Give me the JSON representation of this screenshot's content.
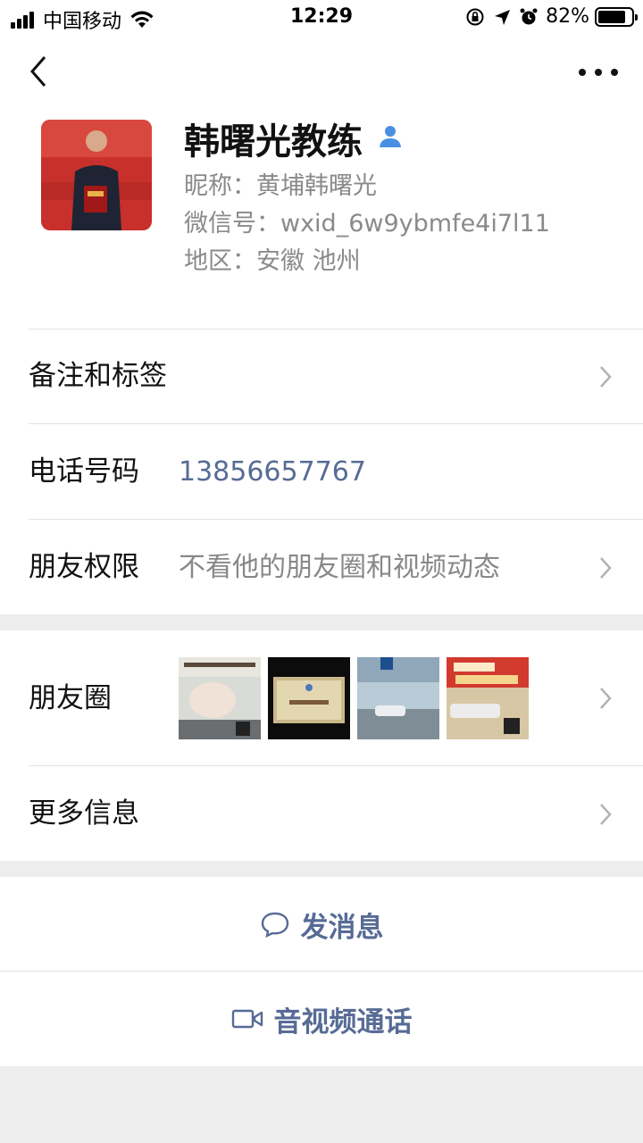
{
  "status_bar": {
    "carrier": "中国移动",
    "time": "12:29",
    "battery": "82%",
    "battery_level": 0.82
  },
  "nav": {
    "back_icon": "chevron-left-icon",
    "more_icon": "ellipsis-icon"
  },
  "profile": {
    "name": "韩曙光教练",
    "nickname": "昵称：黄埔韩曙光",
    "wechat_id": "微信号：wxid_6w9ybmfe4i7l11",
    "region": "地区：安徽 池州"
  },
  "cells": {
    "remark": {
      "label": "备注和标签"
    },
    "phone": {
      "label": "电话号码",
      "value": "13856657767"
    },
    "permission": {
      "label": "朋友权限",
      "value": "不看他的朋友圈和视频动态"
    },
    "moments": {
      "label": "朋友圈"
    },
    "more_info": {
      "label": "更多信息"
    }
  },
  "actions": {
    "message": {
      "label": "发消息",
      "icon": "chat-bubble-icon"
    },
    "call": {
      "label": "音视频通话",
      "icon": "video-camera-icon"
    }
  },
  "colors": {
    "link": "#576b95",
    "background": "#ededed",
    "accent_icon": "#4a90e2"
  }
}
